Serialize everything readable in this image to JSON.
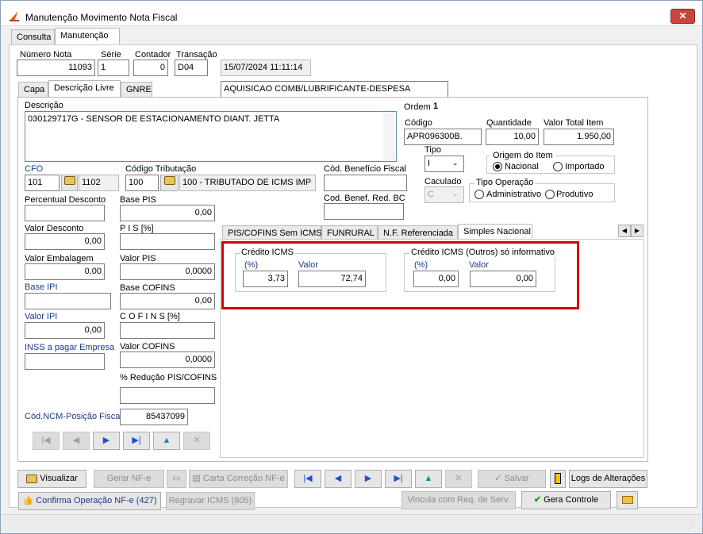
{
  "window": {
    "title": "Manutenção Movimento Nota Fiscal",
    "close": "✕"
  },
  "main_tabs": [
    "Consulta",
    "Manutenção"
  ],
  "header": {
    "numero_nota": {
      "label": "Número Nota",
      "value": "11093"
    },
    "serie": {
      "label": "Série",
      "value": "1"
    },
    "contador": {
      "label": "Contador",
      "value": "0"
    },
    "transacao": {
      "label": "Transação",
      "value": "D04"
    },
    "datetime": "15/07/2024 11:11:14",
    "operacao": "AQUISICAO COMB/LUBRIFICANTE-DESPESA"
  },
  "sub_tabs": [
    "Capa",
    "Descrição Livre",
    "GNRE"
  ],
  "item": {
    "descricao_label": "Descrição",
    "descricao": "030129717G - SENSOR DE ESTACIONAMENTO DIANT. JETTA",
    "ordem_label": "Ordem",
    "ordem": "1",
    "codigo_label": "Código",
    "codigo": "APR096300B.",
    "quantidade_label": "Quantidade",
    "quantidade": "10,00",
    "valor_total_label": "Valor Total Item",
    "valor_total": "1.950,00",
    "tipo_label": "Tipo",
    "tipo": "I",
    "caculado_label": "Caculado",
    "caculado": "C",
    "origem_label": "Origem do Item",
    "origem_nacional": "Nacional",
    "origem_importado": "Importado",
    "tipo_operacao_label": "Tipo Operação",
    "op_administrativo": "Administrativo",
    "op_produtivo": "Produtivo",
    "cfo_label": "CFO",
    "cfo": "101",
    "cfo_desc": "1102",
    "cod_trib_label": "Código Tributação",
    "cod_trib": "100",
    "cod_trib_desc": "100 - TRIBUTADO DE ICMS IMP",
    "cod_beneficio_label": "Cód. Benefício Fiscal",
    "cod_benef_red_label": "Cod. Benef. Red. BC",
    "perc_desconto_label": "Percentual Desconto",
    "base_pis_label": "Base PIS",
    "base_pis": "0,00",
    "valor_desconto_label": "Valor Desconto",
    "valor_desconto": "0,00",
    "pis_perc_label": "P I S  [%]",
    "valor_embalagem_label": "Valor Embalagem",
    "valor_embalagem": "0,00",
    "valor_pis_label": "Valor PIS",
    "valor_pis": "0,0000",
    "base_ipi_label": "Base IPI",
    "base_cofins_label": "Base COFINS",
    "base_cofins": "0,00",
    "valor_ipi_label": "Valor IPI",
    "valor_ipi": "0,00",
    "cofins_perc_label": "C O F I N S  [%]",
    "inss_label": "INSS a pagar Empresa",
    "valor_cofins_label": "Valor COFINS",
    "valor_cofins": "0,0000",
    "reducao_label": "% Redução PIS/COFINS",
    "ncm_label": "Cód.NCM-Posição Fiscal:",
    "ncm": "85437099"
  },
  "inner_tabs": [
    "PIS/COFINS Sem ICMS",
    "FUNRURAL",
    "N.F. Referenciada",
    "Simples Nacional"
  ],
  "simples": {
    "credito_label": "Crédito ICMS",
    "perc_label": "(%)",
    "valor_label": "Valor",
    "perc": "3,73",
    "valor": "72,74",
    "outros_label": "Crédito ICMS (Outros) só informativo",
    "outros_perc": "0,00",
    "outros_valor": "0,00"
  },
  "nav_icons": [
    "|◀",
    "◀",
    "▶",
    "▶|",
    "▲",
    "✕"
  ],
  "bottom": {
    "visualizar": "Visualizar",
    "gerar_nfe": "Gerar NF-e",
    "carta": "Carta Correção NF-e",
    "salvar": "Salvar",
    "logs": "Logs de Alterações",
    "confirma": "Confirma Operação NF-e (427)",
    "regravar": "Regravar ICMS (805)",
    "vincula": "Vincula com Req. de Serv.",
    "gera": "Gera Controle"
  },
  "colors": {
    "accent_red": "#d40000",
    "title_close": "#c9463d"
  }
}
